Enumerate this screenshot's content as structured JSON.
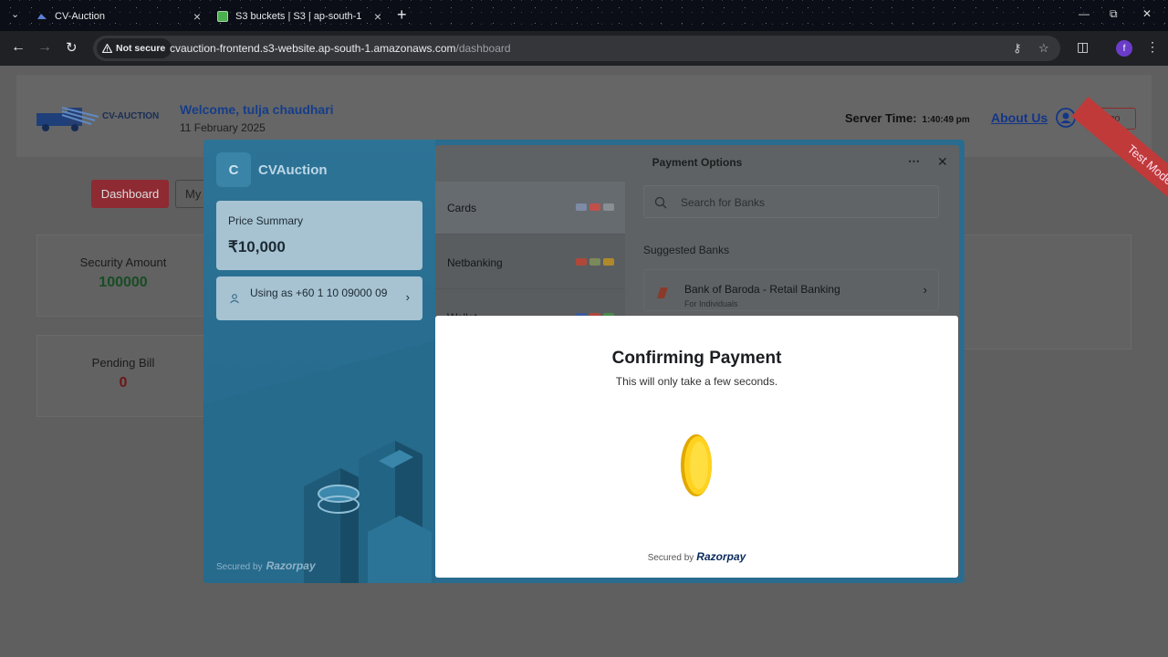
{
  "browser": {
    "tabs": [
      {
        "title": "CV-Auction"
      },
      {
        "title": "S3 buckets | S3 | ap-south-1"
      }
    ],
    "not_secure_label": "Not secure",
    "url_host": "cvauction-frontend.s3-website.ap-south-1.amazonaws.com",
    "url_path": "/dashboard",
    "profile_initial": "f"
  },
  "site": {
    "welcome": "Welcome, tulja chaudhari",
    "date": "11 February 2025",
    "server_time_label": "Server Time:",
    "server_time": "1:40:49 pm",
    "about_label": "About Us",
    "logout_label": "Logo",
    "dashboard_label": "Dashboard",
    "my_label": "My",
    "cards": [
      {
        "label": "Security Amount",
        "value": "100000"
      },
      {
        "label": "Pending Bill",
        "value": "0"
      }
    ],
    "ribbon": "Test Mode"
  },
  "checkout": {
    "brand_initial": "C",
    "brand_name": "CVAuction",
    "price_summary_label": "Price Summary",
    "amount": "₹10,000",
    "using_as": "Using as +60 1 10 09000 09",
    "secured_by": "Secured by",
    "razorpay": "Razorpay",
    "payment_options_title": "Payment Options",
    "methods": [
      {
        "name": "Cards"
      },
      {
        "name": "Netbanking"
      },
      {
        "name": "Wallet"
      }
    ],
    "search_placeholder": "Search for Banks",
    "suggested_label": "Suggested Banks",
    "bank_name": "Bank of Baroda - Retail Banking",
    "bank_sub": "For Individuals"
  },
  "confirm": {
    "title": "Confirming Payment",
    "subtitle": "This will only take a few seconds.",
    "secured_by": "Secured by",
    "razorpay": "Razorpay"
  }
}
